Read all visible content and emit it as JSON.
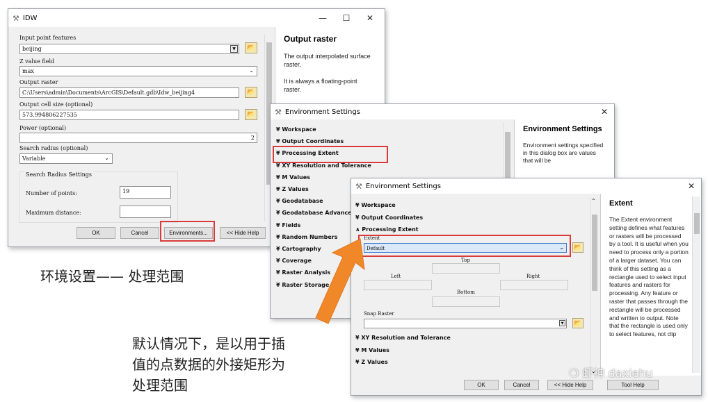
{
  "idw": {
    "title": "IDW",
    "input_label": "Input point features",
    "input_value": "beijing",
    "z_label": "Z value field",
    "z_value": "max",
    "out_label": "Output raster",
    "out_value": "C:\\Users\\admin\\Documents\\ArcGIS\\Default.gdb\\Idw_beijing4",
    "cell_label": "Output cell size (optional)",
    "cell_value": "573.994806227535",
    "power_label": "Power (optional)",
    "power_value": "2",
    "radius_label": "Search radius (optional)",
    "radius_value": "Variable",
    "group_label": "Search Radius Settings",
    "points_label": "Number of points:",
    "points_value": "19",
    "maxdist_label": "Maximum distance:",
    "maxdist_value": "",
    "ok": "OK",
    "cancel": "Cancel",
    "env": "Environments...",
    "hide": "<< Hide Help",
    "help_title": "Output raster",
    "help_p1": "The output interpolated surface raster.",
    "help_p2": "It is always a floating-point raster."
  },
  "env1": {
    "title": "Environment Settings",
    "sections": [
      "Workspace",
      "Output Coordinates",
      "Processing Extent",
      "XY Resolution and Tolerance",
      "M Values",
      "Z Values",
      "Geodatabase",
      "Geodatabase Advanced",
      "Fields",
      "Random Numbers",
      "Cartography",
      "Coverage",
      "Raster Analysis",
      "Raster Storage"
    ],
    "help_title": "Environment Settings",
    "help_p": "Environment settings specified in this dialog box are values that will be"
  },
  "env2": {
    "title": "Environment Settings",
    "sections_top": [
      "Workspace",
      "Output Coordinates",
      "Processing Extent"
    ],
    "extent_label": "Extent",
    "extent_value": "Default",
    "top": "Top",
    "left": "Left",
    "right": "Right",
    "bottom": "Bottom",
    "snap_label": "Snap Raster",
    "sections_bottom": [
      "XY Resolution and Tolerance",
      "M Values",
      "Z Values"
    ],
    "ok": "OK",
    "cancel": "Cancel",
    "hide": "<< Hide Help",
    "toolhelp": "Tool Help",
    "help_title": "Extent",
    "help_p": "The Extent environment setting defines what features or rasters will be processed by a tool. It is useful when you need to process only a portion of a larger dataset. You can think of this setting as a rectangle used to select input features and rasters for processing. Any feature or raster that passes through the rectangle will be processed and written to output. Note that the rectangle is used only to select features, not clip"
  },
  "captions": {
    "c1": "环境设置—— 处理范围",
    "c2_l1": "默认情况下，是以用于插",
    "c2_l2": "值的点数据的外接矩形为",
    "c2_l3": "处理范围"
  },
  "watermark": "虾神 daxiehu",
  "colors": {
    "highlight": "#d93a3a",
    "arrow": "#f0882a"
  }
}
